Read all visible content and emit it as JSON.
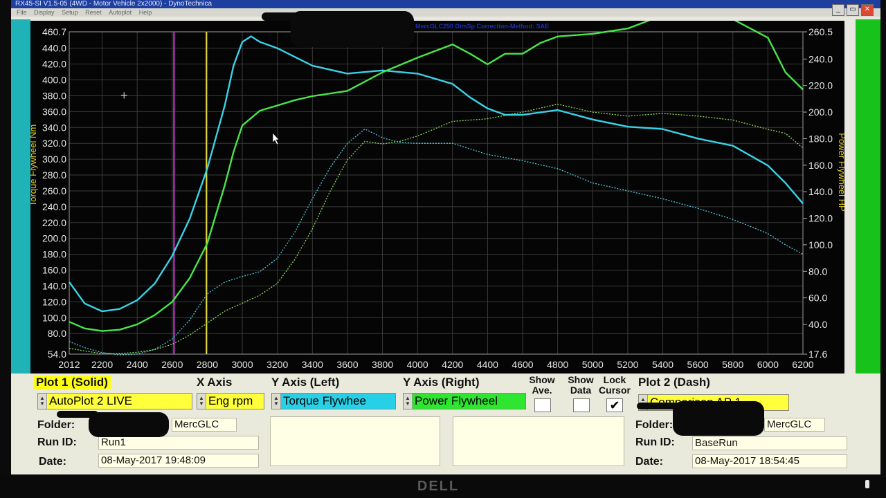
{
  "window": {
    "title": "RX45-SI V1.5-05 (4WD - Motor Vehicle 2x2000) - DynoTechnica",
    "menu": [
      "File",
      "Display",
      "Setup",
      "Reset",
      "Autoplot",
      "Help"
    ],
    "header_info": "MercGLC250 DimSp   Correction-Method: SAE"
  },
  "colors": {
    "torque_solid": "#39d3e8",
    "power_solid": "#48e64a",
    "torque_dash": "#54c9da",
    "power_dash": "#8fdc5f",
    "cursor_magenta": "#d23be0",
    "cursor_yellow": "#e3d93a",
    "left_axis_label": "#e6cf1f",
    "right_axis_label": "#e6cf1f"
  },
  "chart_data": {
    "type": "line",
    "x_label": "",
    "y_left_label": "Torque Flywheel Nm",
    "y_right_label": "Power Flywheel HP",
    "x_ticks": [
      "2012",
      "2200",
      "2400",
      "2600",
      "2800",
      "3000",
      "3200",
      "3400",
      "3600",
      "3800",
      "4000",
      "4200",
      "4400",
      "4600",
      "4800",
      "5000",
      "5200",
      "5400",
      "5600",
      "5800",
      "6000",
      "6200"
    ],
    "y_left_ticks": [
      "460.7",
      "440.0",
      "420.0",
      "400.0",
      "380.0",
      "360.0",
      "340.0",
      "320.0",
      "300.0",
      "280.0",
      "260.0",
      "240.0",
      "220.0",
      "200.0",
      "180.0",
      "160.0",
      "140.0",
      "120.0",
      "100.0",
      "80.0",
      "54.0"
    ],
    "y_right_ticks": [
      "260.5",
      "240.0",
      "220.0",
      "200.0",
      "180.0",
      "160.0",
      "140.0",
      "120.0",
      "100.0",
      "80.0",
      "60.0",
      "40.0",
      "17.6"
    ],
    "x_range": [
      2012,
      6200
    ],
    "y_left_range": [
      54.0,
      460.7
    ],
    "y_right_range": [
      17.6,
      260.5
    ],
    "cursors": [
      2610,
      2795
    ],
    "series": [
      {
        "name": "AutoPlot 2 LIVE — Torque Flywheel",
        "axis": "left",
        "style": "solid",
        "color_key": "torque_solid",
        "x": [
          2012,
          2100,
          2200,
          2300,
          2400,
          2500,
          2600,
          2700,
          2800,
          2900,
          2950,
          3000,
          3050,
          3100,
          3200,
          3400,
          3600,
          3800,
          4000,
          4200,
          4300,
          4400,
          4500,
          4600,
          4800,
          5000,
          5200,
          5400,
          5600,
          5800,
          6000,
          6100,
          6200
        ],
        "y": [
          145,
          118,
          108,
          111,
          122,
          143,
          178,
          225,
          288,
          368,
          418,
          448,
          455,
          448,
          440,
          418,
          408,
          412,
          408,
          395,
          378,
          364,
          356,
          356,
          362,
          350,
          341,
          338,
          326,
          317,
          292,
          270,
          244
        ]
      },
      {
        "name": "AutoPlot 2 LIVE — Power Flywheel",
        "axis": "right",
        "style": "solid",
        "color_key": "power_solid",
        "x": [
          2012,
          2100,
          2200,
          2300,
          2400,
          2500,
          2600,
          2700,
          2800,
          2900,
          2950,
          3000,
          3100,
          3200,
          3300,
          3400,
          3600,
          3800,
          4000,
          4200,
          4300,
          4400,
          4500,
          4600,
          4700,
          4800,
          5000,
          5200,
          5400,
          5600,
          5800,
          6000,
          6100,
          6200
        ],
        "y": [
          42,
          37,
          35,
          36,
          40,
          47,
          57,
          75,
          101,
          145,
          170,
          190,
          201,
          205,
          209,
          212,
          216,
          230,
          241,
          251,
          244,
          236,
          244,
          244,
          252,
          257,
          259,
          263,
          273,
          274,
          270,
          256,
          230,
          217
        ]
      },
      {
        "name": "Comparison AP 1 — Torque Flywheel",
        "axis": "left",
        "style": "dash",
        "color_key": "torque_dash",
        "x": [
          2012,
          2100,
          2200,
          2300,
          2400,
          2500,
          2600,
          2700,
          2800,
          2900,
          3000,
          3100,
          3200,
          3300,
          3400,
          3500,
          3600,
          3700,
          3800,
          3900,
          4000,
          4200,
          4400,
          4600,
          4800,
          5000,
          5200,
          5400,
          5600,
          5800,
          6000,
          6100,
          6200
        ],
        "y": [
          70,
          62,
          56,
          53,
          54,
          60,
          73,
          97,
          130,
          145,
          152,
          158,
          175,
          208,
          250,
          289,
          320,
          338,
          327,
          321,
          320,
          320,
          306,
          298,
          288,
          270,
          260,
          250,
          238,
          224,
          206,
          192,
          180
        ]
      },
      {
        "name": "Comparison AP 1 — Power Flywheel",
        "axis": "right",
        "style": "dash",
        "color_key": "power_dash",
        "x": [
          2012,
          2100,
          2200,
          2300,
          2400,
          2500,
          2600,
          2700,
          2800,
          2900,
          3000,
          3100,
          3200,
          3300,
          3400,
          3500,
          3600,
          3700,
          3800,
          3900,
          4000,
          4200,
          4400,
          4600,
          4800,
          5000,
          5200,
          5400,
          5600,
          5800,
          6000,
          6100,
          6200
        ],
        "y": [
          22,
          20,
          18,
          18,
          19,
          21,
          25,
          32,
          41,
          50,
          56,
          62,
          71,
          89,
          112,
          140,
          164,
          178,
          176,
          178,
          182,
          193,
          195,
          200,
          206,
          200,
          197,
          199,
          197,
          194,
          187,
          184,
          173
        ]
      }
    ]
  },
  "panel": {
    "plot1_header": "Plot 1 (Solid)",
    "plot1_select": "AutoPlot 2 LIVE",
    "x_axis_header": "X Axis",
    "x_axis_select": "Eng rpm",
    "y_left_header": "Y Axis (Left)",
    "y_left_select": "Torque Flywhee",
    "y_right_header": "Y Axis (Right)",
    "y_right_select": "Power Flywheel",
    "show_ave": "Show Ave.",
    "show_data": "Show Data",
    "lock_cursor": "Lock Cursor",
    "lock_cursor_checked": "✔",
    "plot2_header": "Plot 2 (Dash)",
    "plot2_select": "Comparison AP 1",
    "left": {
      "folder_label": "Folder:",
      "folder_value": "MercGLC",
      "runid_label": "Run ID:",
      "runid_value": "Run1",
      "date_label": "Date:",
      "date_value": "08-May-2017  19:48:09"
    },
    "right": {
      "folder_label": "Folder:",
      "folder_value": "MercGLC",
      "runid_label": "Run ID:",
      "runid_value": "BaseRun",
      "date_label": "Date:",
      "date_value": "08-May-2017  18:54:45"
    }
  },
  "bezel": {
    "brand": "DELL"
  }
}
